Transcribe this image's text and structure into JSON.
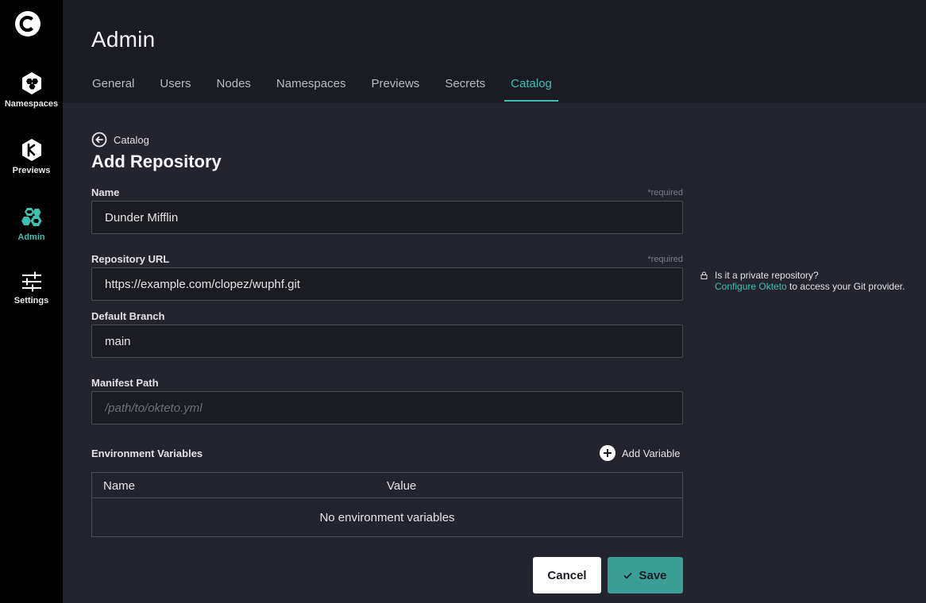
{
  "sidebar": {
    "logo": "okteto-logo",
    "items": [
      {
        "label": "Namespaces",
        "icon": "namespaces-icon"
      },
      {
        "label": "Previews",
        "icon": "previews-icon"
      },
      {
        "label": "Admin",
        "icon": "admin-icon",
        "active": true
      },
      {
        "label": "Settings",
        "icon": "settings-icon"
      }
    ]
  },
  "header": {
    "title": "Admin",
    "tabs": [
      {
        "label": "General"
      },
      {
        "label": "Users"
      },
      {
        "label": "Nodes"
      },
      {
        "label": "Namespaces"
      },
      {
        "label": "Previews"
      },
      {
        "label": "Secrets"
      },
      {
        "label": "Catalog",
        "active": true
      }
    ]
  },
  "form": {
    "back_label": "Catalog",
    "title": "Add Repository",
    "required_note": "*required",
    "name": {
      "label": "Name",
      "value": "Dunder Mifflin"
    },
    "repo_url": {
      "label": "Repository URL",
      "value": "https://example.com/clopez/wuphf.git"
    },
    "default_branch": {
      "label": "Default Branch",
      "value": "main"
    },
    "manifest_path": {
      "label": "Manifest Path",
      "value": "",
      "placeholder": "/path/to/okteto.yml"
    },
    "env_vars": {
      "label": "Environment Variables",
      "add_label": "Add Variable",
      "columns": [
        "Name",
        "Value"
      ],
      "empty_text": "No environment variables"
    },
    "cancel_label": "Cancel",
    "save_label": "Save"
  },
  "hint": {
    "line1": "Is it a private repository?",
    "link": "Configure Okteto",
    "line2_rest": " to access your Git provider."
  },
  "colors": {
    "accent": "#3fbfb0",
    "save_button": "#3a9e94",
    "sidebar_bg": "#000000",
    "header_bg": "#1b1c23",
    "content_bg": "#23242d"
  }
}
